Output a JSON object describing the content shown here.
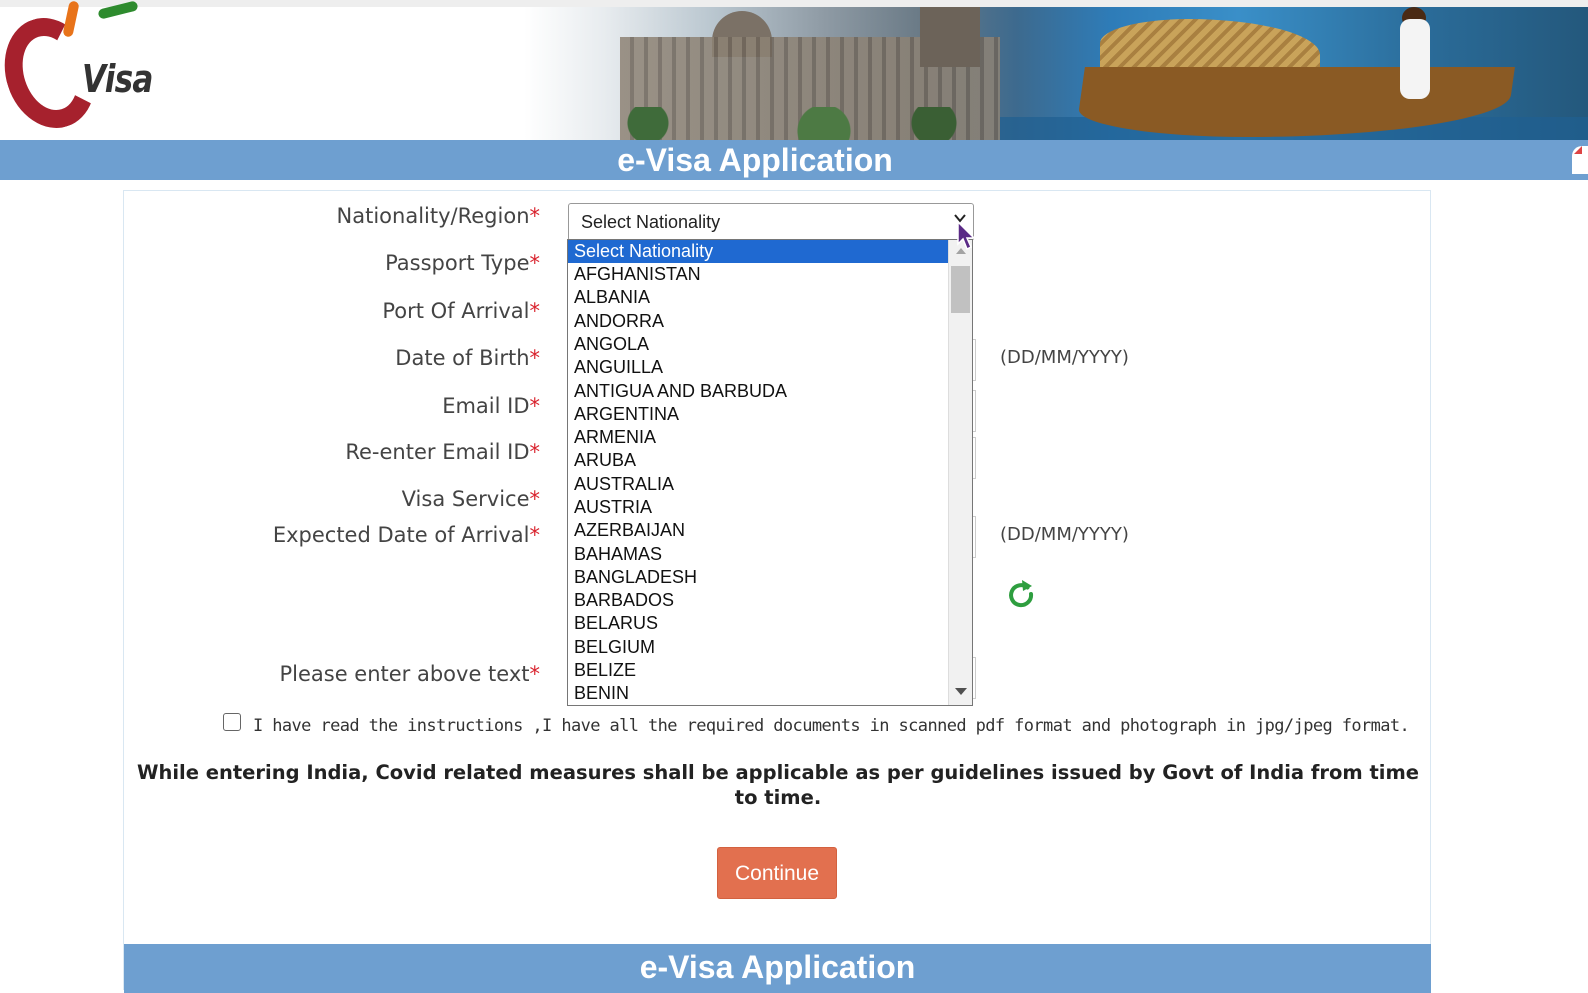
{
  "header": {
    "logo_text": "Visa",
    "title": "e-Visa Application"
  },
  "form": {
    "labels": {
      "nationality": "Nationality/Region",
      "passport_type": "Passport Type",
      "port_of_arrival": "Port Of Arrival",
      "date_of_birth": "Date of Birth",
      "email": "Email ID",
      "reenter_email": "Re-enter Email ID",
      "visa_service": "Visa Service",
      "expected_arrival": "Expected Date of Arrival",
      "captcha": "Please enter above text"
    },
    "required_mark": "*",
    "date_hint": "(DD/MM/YYYY)",
    "nationality_select": {
      "value": "Select Nationality",
      "options": [
        "Select Nationality",
        "AFGHANISTAN",
        "ALBANIA",
        "ANDORRA",
        "ANGOLA",
        "ANGUILLA",
        "ANTIGUA AND BARBUDA",
        "ARGENTINA",
        "ARMENIA",
        "ARUBA",
        "AUSTRALIA",
        "AUSTRIA",
        "AZERBAIJAN",
        "BAHAMAS",
        "BANGLADESH",
        "BARBADOS",
        "BELARUS",
        "BELGIUM",
        "BELIZE",
        "BENIN"
      ],
      "selected_index": 0
    },
    "instructions_checkbox": {
      "label": "I have read the instructions ,I have all the required documents in scanned pdf format and photograph in jpg/jpeg format.",
      "checked": false
    },
    "covid_notice": "While entering India, Covid related measures shall be applicable as per guidelines issued by Govt of India from time to time.",
    "continue_label": "Continue"
  },
  "footer": {
    "title": "e-Visa Application"
  },
  "colors": {
    "title_bar": "#6e9fd0",
    "required": "#d9232e",
    "continue_button": "#e2704f",
    "selected_option": "#1f69d1",
    "refresh_icon": "#2e9e3f"
  },
  "icons": [
    "home-icon",
    "chevron-down-icon",
    "refresh-icon",
    "mouse-cursor-icon"
  ]
}
